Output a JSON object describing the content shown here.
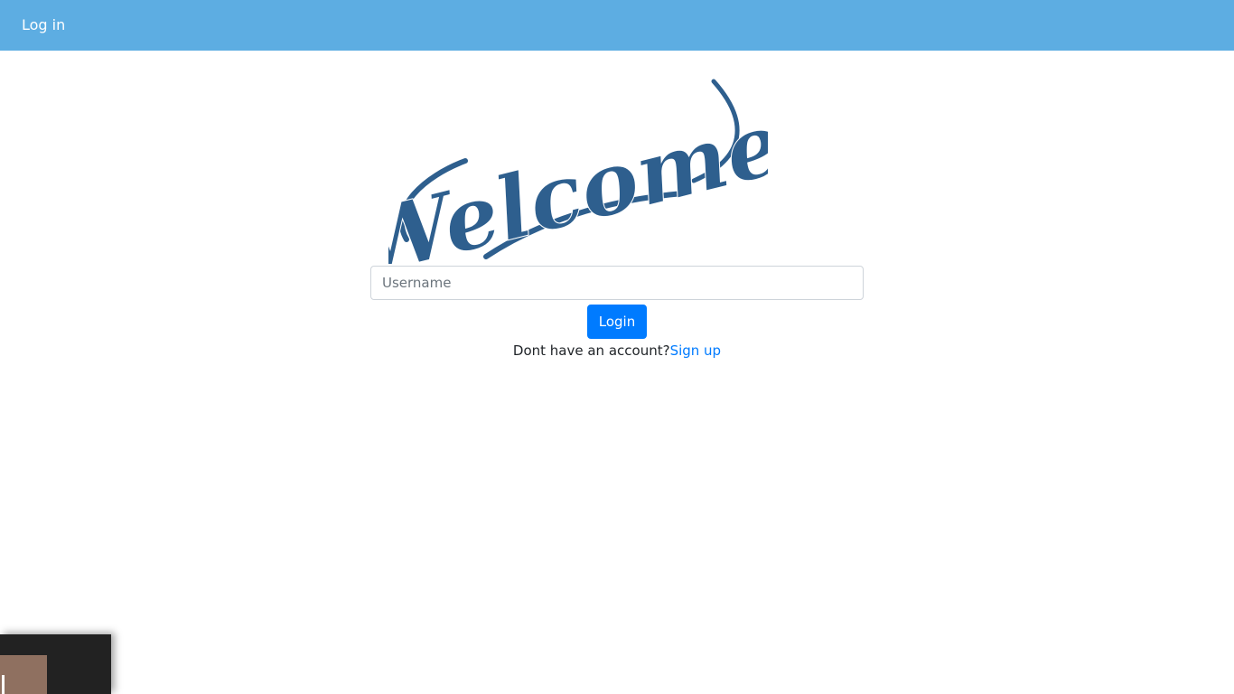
{
  "navbar": {
    "title": "Log in"
  },
  "welcome": {
    "logo_text": "Welcome",
    "logo_color": "#2e5f8e"
  },
  "form": {
    "username_placeholder": "Username",
    "login_label": "Login",
    "signup_prompt": "Dont have an account?",
    "signup_link": "Sign up"
  },
  "colors": {
    "navbar_bg": "#5dade2",
    "primary": "#007bff"
  }
}
